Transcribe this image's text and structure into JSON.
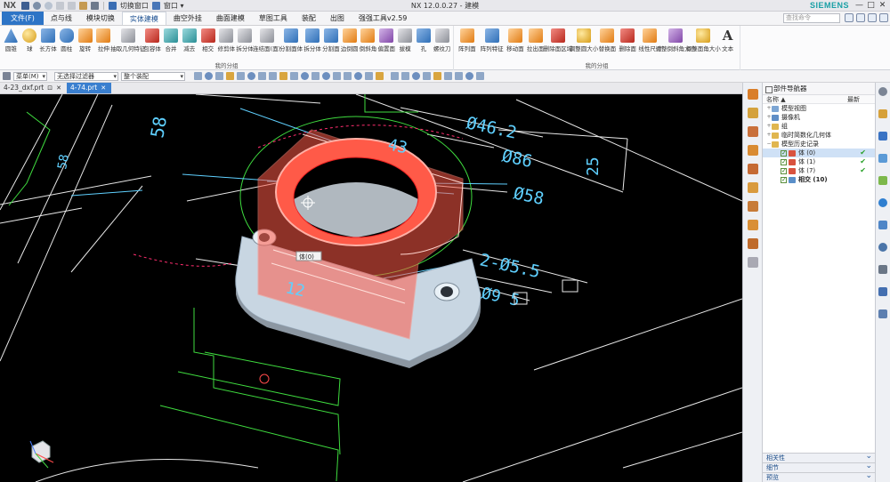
{
  "titlebar": {
    "logo": "NX",
    "switch_window": "切换窗口",
    "window_menu": "窗口 ▾",
    "title": "NX 12.0.0.27 - 建模",
    "brand": "SIEMENS",
    "controls": {
      "minimize": "—",
      "maximize": "□",
      "close": "✕"
    }
  },
  "menu_tabs": [
    "文件(F)",
    "点与线",
    "模块切换",
    "实体建模",
    "曲空外挂",
    "曲面建模",
    "草图工具",
    "装配",
    "出图",
    "强强工具v2.59"
  ],
  "search": {
    "placeholder": "查找命令"
  },
  "ribbon": {
    "group1": {
      "caption": "我的分组",
      "buttons": [
        "圆锥",
        "球",
        "长方体",
        "圆柱",
        "旋转",
        "拉伸",
        "抽取几何特征",
        "包容体",
        "合并",
        "减去",
        "相交",
        "修剪体",
        "拆分体",
        "连结面(面)",
        "分割面体",
        "拆分体",
        "分割面",
        "边倒圆",
        "倒斜角",
        "偏置面",
        "拔模",
        "孔",
        "螺纹刀"
      ]
    },
    "group2": {
      "caption": "我的分组",
      "buttons": [
        "阵列面",
        "阵列特征",
        "移动面",
        "拉出面",
        "删除面区域",
        "调整圆大小",
        "替换面",
        "删除面",
        "线性尺寸",
        "调整倒斜角大小",
        "调整面角大小",
        "文本"
      ]
    }
  },
  "toolbar2": {
    "menu": "菜单(M)",
    "type_filter": "无选择过滤器",
    "scope": "整个装配"
  },
  "doc_tabs": [
    {
      "label": "4-23_dxf.prt"
    },
    {
      "label": "4-74.prt"
    }
  ],
  "viewport": {
    "dims": [
      "58",
      "58",
      "Ø46.2",
      "43",
      "Ø86",
      "25",
      "Ø58",
      "2-Ø5.5",
      "Ø9 5",
      "12"
    ],
    "tooltip": "体(0)"
  },
  "navigator": {
    "title": "部件导航器",
    "columns": [
      "名称 ▲",
      "最新"
    ],
    "items": [
      {
        "label": "模型视图"
      },
      {
        "label": "摄像机"
      },
      {
        "label": "组"
      },
      {
        "label": "临时简数化几何体"
      },
      {
        "label": "模型历史记录"
      },
      {
        "label": "体 (0)",
        "latest": "✔"
      },
      {
        "label": "体 (1)",
        "latest": "✔"
      },
      {
        "label": "体 (7)",
        "latest": "✔"
      },
      {
        "label": "相交 (10)"
      }
    ],
    "panels": [
      "相关性",
      "细节",
      "预览"
    ]
  }
}
